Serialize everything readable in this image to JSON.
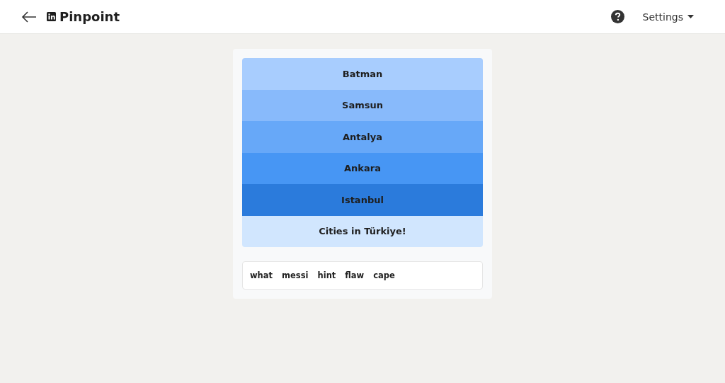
{
  "header": {
    "title": "Pinpoint",
    "settings": "Settings"
  },
  "clues": [
    {
      "text": "Batman",
      "color": "#a8cdfe"
    },
    {
      "text": "Samsun",
      "color": "#88bafb"
    },
    {
      "text": "Antalya",
      "color": "#67a8f8"
    },
    {
      "text": "Ankara",
      "color": "#4796f4"
    },
    {
      "text": "Istanbul",
      "color": "#2b7bdc"
    },
    {
      "text": "Cities in Türkiye!",
      "color": "#d1e6fe"
    }
  ],
  "guesses": [
    "what",
    "messi",
    "hint",
    "flaw",
    "cape"
  ]
}
